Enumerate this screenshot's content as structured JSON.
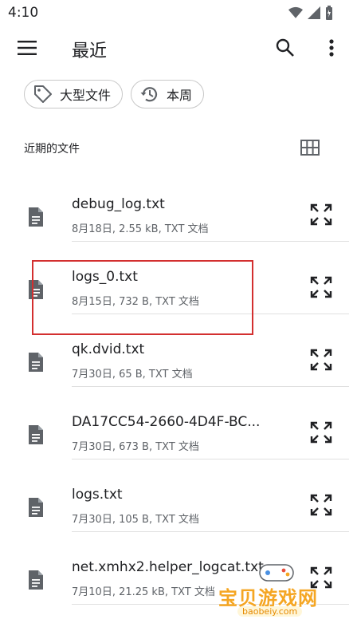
{
  "status_bar": {
    "time": "4:10"
  },
  "app_bar": {
    "title": "最近"
  },
  "chips": [
    {
      "label": "大型文件",
      "icon": "tag-icon"
    },
    {
      "label": "本周",
      "icon": "history-icon"
    }
  ],
  "section": {
    "title": "近期的文件"
  },
  "files": [
    {
      "name": "debug_log.txt",
      "meta": "8月18日, 2.55 kB, TXT 文档"
    },
    {
      "name": "logs_0.txt",
      "meta": "8月15日, 732 B, TXT 文档"
    },
    {
      "name": "qk.dvid.txt",
      "meta": "7月30日, 65 B, TXT 文档"
    },
    {
      "name": "DA17CC54-2660-4D4F-BC...",
      "meta": "7月30日, 673 B, TXT 文档"
    },
    {
      "name": "logs.txt",
      "meta": "7月30日, 105 B, TXT 文档"
    },
    {
      "name": "net.xmhx2.helper_logcat.txt",
      "meta": "7月10日, 21.25 kB, TXT 文档"
    }
  ],
  "watermark": {
    "title": "宝贝游戏网",
    "url": "baobeiy.com"
  },
  "colors": {
    "highlight": "#d32f2f",
    "icon": "#5f6368",
    "text": "#202124"
  }
}
